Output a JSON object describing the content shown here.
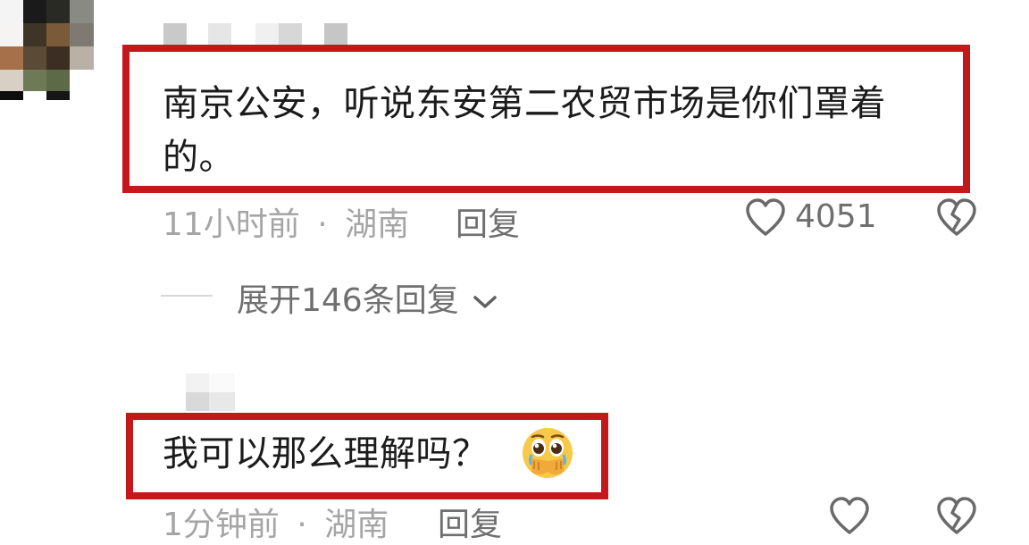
{
  "comments": [
    {
      "text_line1": "南京公安，听说东安第二农贸市场是你们罩着",
      "text_line2": "的。",
      "time": "11小时前",
      "separator": "·",
      "location": "湖南",
      "reply_label": "回复",
      "like_count": "4051"
    },
    {
      "text": "我可以那么理解吗？",
      "emoji": "pleading-face-hands-over-mouth",
      "time": "1分钟前",
      "separator": "·",
      "location": "湖南",
      "reply_label": "回复"
    }
  ],
  "expand_replies": {
    "label": "展开146条回复"
  },
  "colors": {
    "highlight": "#c4191b",
    "meta": "#a5a5a5",
    "action": "#6f6f6f"
  }
}
